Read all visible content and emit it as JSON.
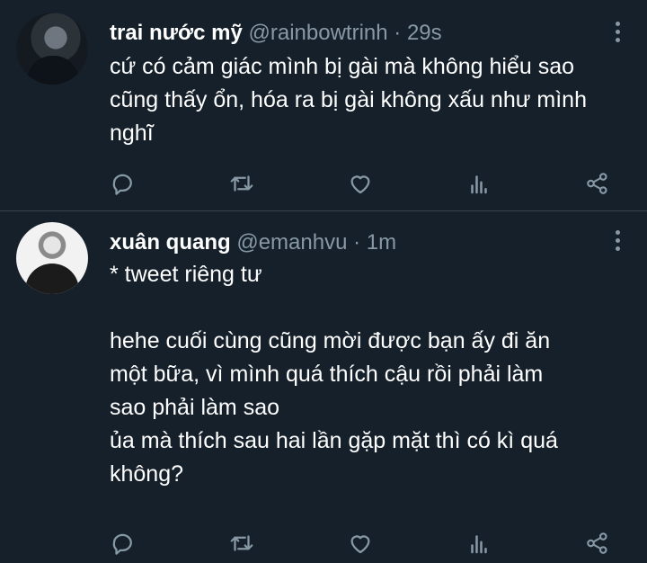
{
  "tweets": [
    {
      "name": "trai nước mỹ",
      "handle": "@rainbowtrinh",
      "separator": "·",
      "time": "29s",
      "text": "cứ có cảm giác mình bị gài mà không hiểu sao\ncũng thấy ổn, hóa ra bị gài không xấu như mình\nnghĩ"
    },
    {
      "name": "xuân quang",
      "handle": "@emanhvu",
      "separator": "·",
      "time": "1m",
      "text": "* tweet riêng tư\n\nhehe cuối cùng cũng mời được bạn ấy đi ăn\nmột bữa, vì mình quá thích cậu rồi phải làm\nsao phải làm sao\nủa mà thích sau hai lần gặp mặt thì có kì quá\nkhông?"
    }
  ],
  "icons": [
    "reply-icon",
    "retweet-icon",
    "like-icon",
    "analytics-icon",
    "share-icon"
  ],
  "colors": {
    "background": "#15202b",
    "muted": "#8899a6",
    "divider": "#38444d",
    "text": "#ffffff"
  }
}
